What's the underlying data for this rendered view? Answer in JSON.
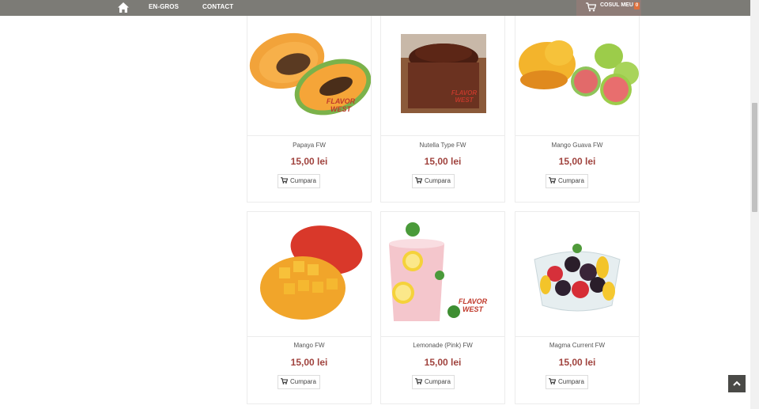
{
  "nav": {
    "items": [
      "En-gros",
      "Contact"
    ],
    "cart_label": "Cosul meu",
    "cart_count": "0"
  },
  "products": [
    {
      "name": "Papaya FW",
      "price": "15,00 lei",
      "button": "Cumpara",
      "watermark": "FLAVOR WEST"
    },
    {
      "name": "Nutella Type FW",
      "price": "15,00 lei",
      "button": "Cumpara",
      "watermark": "FLAVOR WEST"
    },
    {
      "name": "Mango Guava FW",
      "price": "15,00 lei",
      "button": "Cumpara"
    },
    {
      "name": "Mango FW",
      "price": "15,00 lei",
      "button": "Cumpara"
    },
    {
      "name": "Lemonade (Pink) FW",
      "price": "15,00 lei",
      "button": "Cumpara",
      "watermark": "FLAVOR WEST"
    },
    {
      "name": "Magma Current FW",
      "price": "15,00 lei",
      "button": "Cumpara"
    }
  ],
  "icons": {
    "home": "home-icon",
    "cart": "cart-icon",
    "back_to_top": "chevron-up-icon"
  },
  "colors": {
    "navbar": "#7c7b76",
    "price": "#a0433e",
    "cart_badge": "#e0703c"
  }
}
